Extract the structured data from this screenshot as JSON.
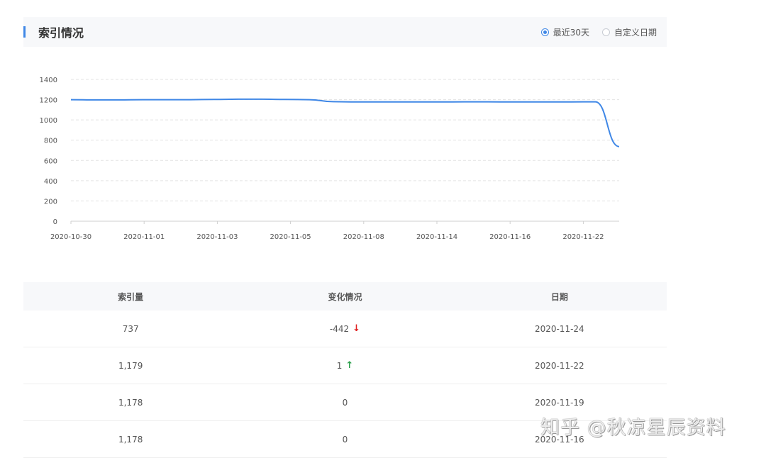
{
  "section": {
    "title": "索引情况"
  },
  "radios": [
    {
      "label": "最近30天",
      "checked": true
    },
    {
      "label": "自定义日期",
      "checked": false
    }
  ],
  "chart_data": {
    "type": "line",
    "title": "",
    "xlabel": "",
    "ylabel": "",
    "ylim": [
      0,
      1400
    ],
    "yticks": [
      0,
      200,
      400,
      600,
      800,
      1000,
      1200,
      1400
    ],
    "x_tick_labels": [
      "2020-10-30",
      "2020-11-01",
      "2020-11-03",
      "2020-11-05",
      "2020-11-08",
      "2020-11-14",
      "2020-11-16",
      "2020-11-22"
    ],
    "grid": true,
    "line_color": "#3f87e6",
    "series": [
      {
        "values": [
          1200,
          1198,
          1198,
          1200,
          1200,
          1200,
          1202,
          1205,
          1205,
          1202,
          1200,
          1180,
          1178,
          1178,
          1178,
          1178,
          1178,
          1179,
          1178,
          1178,
          1178,
          1178,
          1179,
          737
        ]
      }
    ]
  },
  "table": {
    "headers": [
      "索引量",
      "变化情况",
      "日期"
    ],
    "rows": [
      {
        "count": "737",
        "change": "-442",
        "trend": "down",
        "date": "2020-11-24"
      },
      {
        "count": "1,179",
        "change": "1",
        "trend": "up",
        "date": "2020-11-22"
      },
      {
        "count": "1,178",
        "change": "0",
        "trend": "none",
        "date": "2020-11-19"
      },
      {
        "count": "1,178",
        "change": "0",
        "trend": "none",
        "date": "2020-11-16"
      }
    ]
  },
  "icons": {
    "down": "↓",
    "up": "↑"
  },
  "watermark": "知乎 @秋凉星辰资料"
}
